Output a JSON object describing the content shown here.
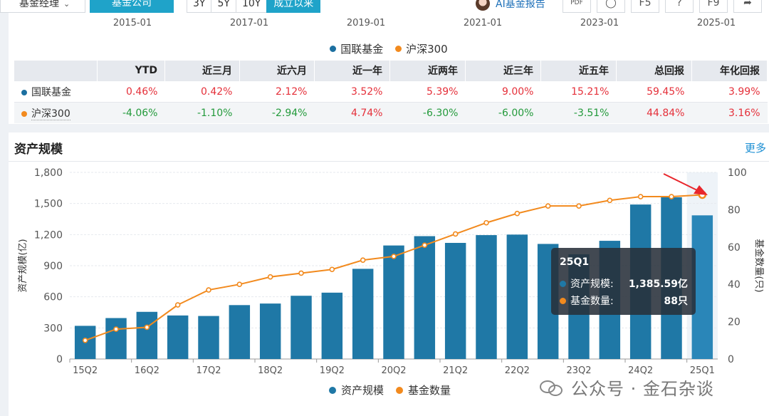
{
  "toolbar": {
    "manager_dropdown": "基金经理",
    "company_tab": "基金公司",
    "ranges": [
      "3Y",
      "5Y",
      "10Y",
      "成立以来"
    ],
    "ai_label": "AI基金报告",
    "pdf_label": "PDF",
    "f5_label": "F5",
    "help_label": "?",
    "f9_label": "F9"
  },
  "performance": {
    "year_ticks": [
      "2015-01",
      "2017-01",
      "2019-01",
      "2021-01",
      "2023-01",
      "2025-01"
    ],
    "legend": [
      {
        "name": "国联基金",
        "color": "#1b6fa0"
      },
      {
        "name": "沪深300",
        "color": "#f28a1e"
      }
    ],
    "columns": [
      "YTD",
      "近三月",
      "近六月",
      "近一年",
      "近两年",
      "近三年",
      "近五年",
      "总回报",
      "年化回报"
    ],
    "rows": [
      {
        "name": "国联基金",
        "color": "#1b6fa0",
        "values": [
          "0.46%",
          "0.42%",
          "2.12%",
          "3.52%",
          "5.39%",
          "9.00%",
          "15.21%",
          "59.45%",
          "3.99%"
        ],
        "signs": [
          "pos",
          "pos",
          "pos",
          "pos",
          "pos",
          "pos",
          "pos",
          "pos",
          "pos"
        ]
      },
      {
        "name": "沪深300",
        "color": "#f28a1e",
        "values": [
          "-4.06%",
          "-1.10%",
          "-2.94%",
          "4.74%",
          "-6.30%",
          "-6.00%",
          "-3.51%",
          "44.84%",
          "3.16%"
        ],
        "signs": [
          "neg",
          "neg",
          "neg",
          "pos",
          "neg",
          "neg",
          "neg",
          "pos",
          "pos"
        ]
      }
    ]
  },
  "asset_section": {
    "title": "资产规模",
    "more": "更多",
    "tooltip": {
      "period": "25Q1",
      "aum_label": "资产规模:",
      "aum_value": "1,385.59亿",
      "count_label": "基金数量:",
      "count_value": "88只"
    },
    "watermark": "公众号 · 金石杂谈"
  },
  "chart_data": {
    "type": "bar",
    "categories": [
      "15Q2",
      "15Q4",
      "16Q2",
      "16Q4",
      "17Q2",
      "17Q4",
      "18Q2",
      "18Q4",
      "19Q2",
      "19Q4",
      "20Q2",
      "20Q4",
      "21Q2",
      "21Q4",
      "22Q2",
      "22Q4",
      "23Q2",
      "23Q4",
      "24Q2",
      "24Q4",
      "25Q1"
    ],
    "x_tick_labels": [
      "15Q2",
      "16Q2",
      "17Q2",
      "18Q2",
      "19Q2",
      "20Q2",
      "21Q2",
      "22Q2",
      "23Q2",
      "24Q2",
      "25Q1"
    ],
    "series": [
      {
        "name": "资产规模",
        "type": "bar",
        "axis": "left",
        "color": "#1f78a6",
        "values": [
          320,
          395,
          455,
          420,
          415,
          520,
          535,
          610,
          640,
          870,
          1095,
          1185,
          1120,
          1195,
          1200,
          1110,
          1010,
          1140,
          1490,
          1560,
          1385.59
        ]
      },
      {
        "name": "基金数量",
        "type": "line",
        "axis": "right",
        "color": "#f28a1e",
        "values": [
          10,
          16,
          17,
          29,
          37,
          40,
          44,
          46,
          48,
          53,
          55,
          61,
          67,
          73,
          78,
          82,
          82,
          85,
          87,
          87,
          88
        ]
      }
    ],
    "ylabel_left": "资产规模(亿)",
    "ylabel_right": "基金数量(只)",
    "ylim_left": [
      0,
      1800
    ],
    "yticks_left": [
      "0",
      "300",
      "600",
      "900",
      "1,200",
      "1,500",
      "1,800"
    ],
    "ylim_right": [
      0,
      100
    ],
    "yticks_right": [
      "0",
      "20",
      "40",
      "60",
      "80",
      "100"
    ],
    "legend_position": "bottom-center",
    "highlight_category": "25Q1",
    "grid": true
  }
}
